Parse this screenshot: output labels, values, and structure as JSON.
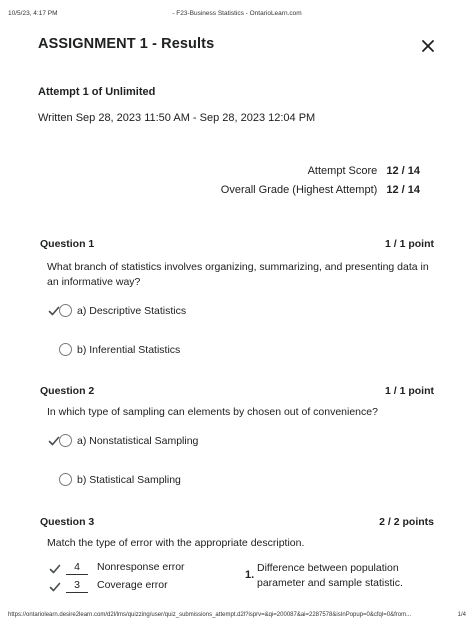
{
  "print_header": {
    "datetime": "10/5/23, 4:17 PM",
    "doc_title": "- F23-Business Statistics - OntarioLearn.com"
  },
  "header": {
    "title": "ASSIGNMENT 1 - Results",
    "close_icon": "close-x-icon"
  },
  "attempt": {
    "label": "Attempt 1 of Unlimited",
    "written": "Written Sep 28, 2023 11:50 AM - Sep 28, 2023 12:04 PM"
  },
  "scores": {
    "attempt_score_label": "Attempt Score",
    "attempt_score_value": "12 / 14",
    "overall_grade_label": "Overall Grade (Highest Attempt)",
    "overall_grade_value": "12 / 14"
  },
  "questions": [
    {
      "title": "Question 1",
      "points": "1 / 1 point",
      "text": "What branch of statistics involves organizing, summarizing, and presenting data in an informative way?",
      "options": [
        {
          "label": "a)  Descriptive Statistics",
          "correct": true
        },
        {
          "label": "b)  Inferential Statistics",
          "correct": false
        }
      ]
    },
    {
      "title": "Question 2",
      "points": "1 / 1 point",
      "text": "In which type of sampling can elements by chosen out of convenience?",
      "options": [
        {
          "label": "a)  Nonstatistical Sampling",
          "correct": true
        },
        {
          "label": "b)  Statistical Sampling",
          "correct": false
        }
      ]
    },
    {
      "title": "Question 3",
      "points": "2 / 2 points",
      "text": "Match the type of error with the appropriate description.",
      "matches": [
        {
          "answer": "4",
          "label": "Nonresponse error"
        },
        {
          "answer": "3",
          "label": "Coverage error"
        }
      ],
      "descriptions": [
        {
          "num": "1.",
          "text": "Difference between population parameter and sample statistic."
        }
      ]
    }
  ],
  "print_footer": {
    "url": "https://ontariolearn.desire2learn.com/d2l/lms/quizzing/user/quiz_submissions_attempt.d2l?isprv=&qi=200087&ai=2287578&isInPopup=0&cfql=0&from...",
    "page": "1/4"
  },
  "colors": {
    "text": "#202122",
    "check": "#494c4e",
    "radio_border": "#7a7a7a"
  }
}
